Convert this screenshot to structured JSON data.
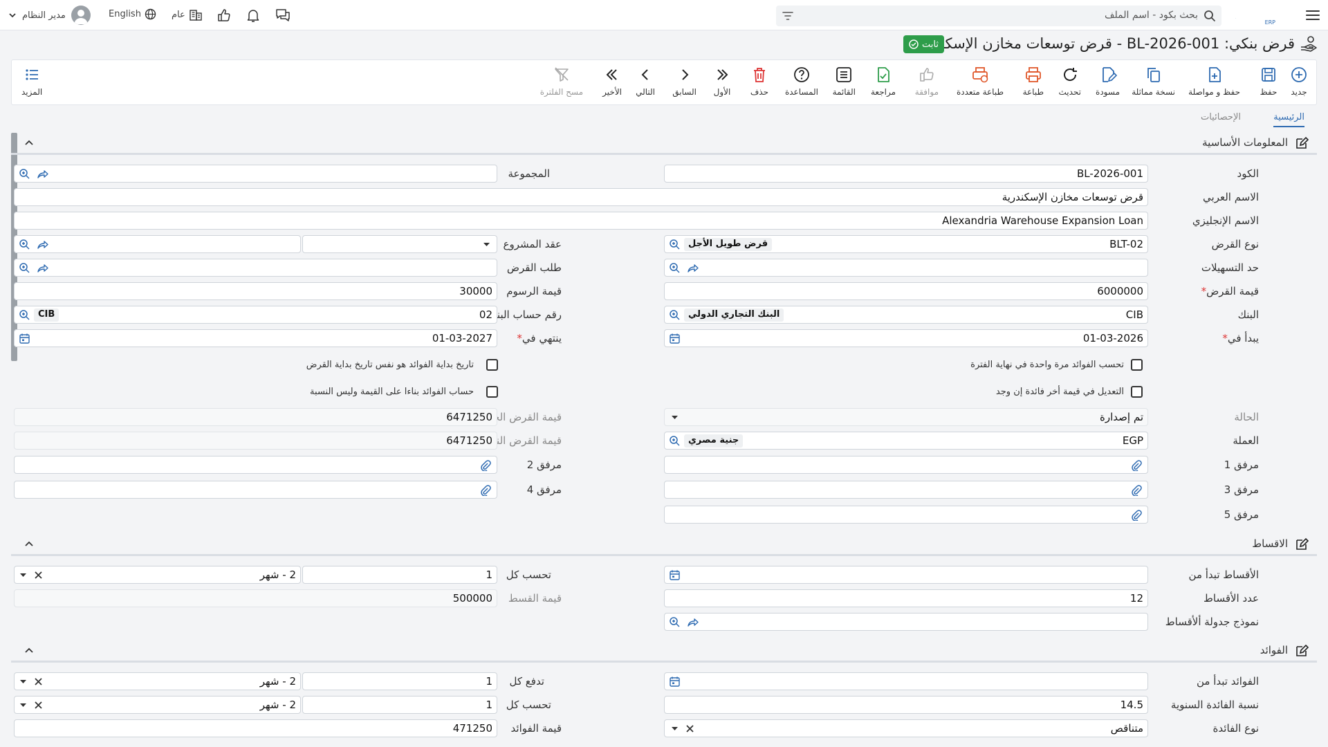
{
  "header": {
    "search_placeholder": "بحث بكود - اسم الملف",
    "user_name": "مدير النظام",
    "language": "English",
    "scope": "عام",
    "logo": "NAMA ERP"
  },
  "page": {
    "title": "قرض بنكي: BL-2026-001 - قرض توسعات مخازن الإسكندرية",
    "status_badge": "ثابت"
  },
  "toolbar": {
    "new": "جديد",
    "save": "حفظ",
    "save_continue": "حفظ و مواصلة",
    "duplicate": "نسخة مماثلة",
    "draft": "مسودة",
    "refresh": "تحديث",
    "print": "طباعة",
    "multi_print": "طباعة متعددة",
    "approve": "موافقة",
    "review": "مراجعة",
    "list": "القائمة",
    "help": "المساعدة",
    "delete": "حذف",
    "first": "الأول",
    "previous": "السابق",
    "next": "التالي",
    "last": "الأخير",
    "clear_filter": "مسح الفلترة",
    "more": "المزيد"
  },
  "tabs": [
    "الرئيسية",
    "الإحصائيات"
  ],
  "sections": {
    "basic": "المعلومات الأساسية",
    "installments": "الاقساط",
    "interest": "الفوائد"
  },
  "basic": {
    "code_label": "الكود",
    "code": "BL-2026-001",
    "group_label": "المجموعة",
    "arabic_name_label": "الاسم العربي",
    "arabic_name": "قرض توسعات مخازن الإسكندرية",
    "english_name_label": "الاسم الإنجليزي",
    "english_name": "Alexandria Warehouse Expansion Loan",
    "loan_type_label": "نوع القرض",
    "loan_type_code": "BLT-02",
    "loan_type_name": "قرض طويل الأجل",
    "project_contract_label": "عقد المشروع",
    "credit_limit_label": "حد التسهيلات",
    "loan_request_label": "طلب القرض",
    "loan_value_label": "قيمة القرض",
    "loan_value": "6000000",
    "fees_value_label": "قيمة الرسوم",
    "fees_value": "30000",
    "bank_label": "البنك",
    "bank_code": "CIB",
    "bank_name": "البنك التجاري الدولي",
    "bank_account_label": "رقم حساب البنك",
    "bank_account": "02",
    "bank_account_chip": "CIB",
    "starts_label": "يبدأ في",
    "starts": "01-03-2026",
    "ends_label": "ينتهي في",
    "ends": "01-03-2027",
    "cb1": "تحسب الفوائد مرة واحدة في نهاية الفترة",
    "cb2": "تاريخ بداية الفوائد هو نفس تاريخ بداية القرض",
    "cb3": "التعديل في قيمة أخر فائدة إن وجد",
    "cb4": "حساب الفوائد بناءا على القيمة وليس النسبة",
    "status_label": "الحالة",
    "status": "تم إصدارة",
    "current_value_label": "قيمة القرض الحالية",
    "current_value": "6471250",
    "currency_label": "العملة",
    "currency_code": "EGP",
    "currency_name": "جنية مصري",
    "final_value_label": "قيمة القرض النهائية",
    "final_value": "6471250",
    "att1": "مرفق 1",
    "att2": "مرفق 2",
    "att3": "مرفق 3",
    "att4": "مرفق 4",
    "att5": "مرفق 5"
  },
  "installments": {
    "start_label": "الأقساط تبدأ من",
    "calc_every_label": "تحسب كل",
    "calc_every": "1",
    "calc_unit": "2 - شهر",
    "count_label": "عدد الأقساط",
    "count": "12",
    "amount_label": "قيمة القسط",
    "amount": "500000",
    "template_label": "نموذج جدولة ألأقساط"
  },
  "interest": {
    "start_label": "الفوائد تبدأ من",
    "pay_every_label": "تدفع كل",
    "pay_every": "1",
    "pay_unit": "2 - شهر",
    "rate_label": "نسبة الفائدة السنوية",
    "rate": "14.5",
    "calc_every_label": "تحسب كل",
    "calc_every": "1",
    "calc_unit": "2 - شهر",
    "type_label": "نوع الفائدة",
    "type": "متناقص",
    "value_label": "قيمة الفوائد",
    "value": "471250"
  },
  "colors": {
    "accent": "#2d6ab1",
    "badge": "#2e9d4a",
    "required": "#d33"
  }
}
